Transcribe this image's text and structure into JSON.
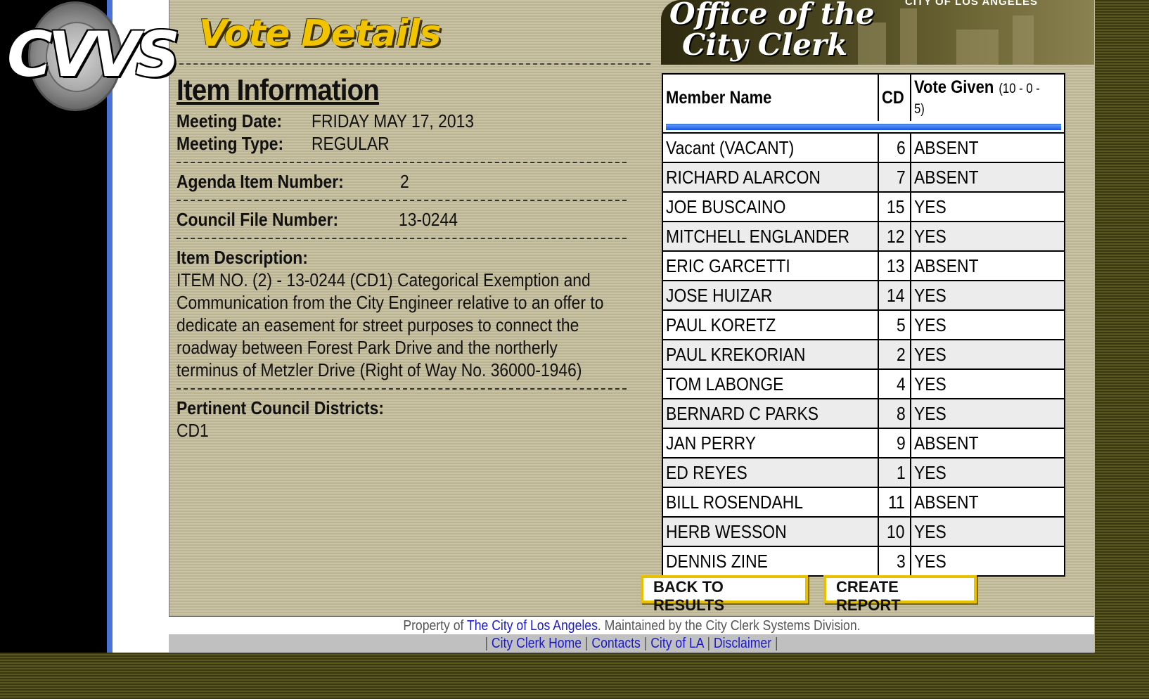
{
  "brand": {
    "logo_text": "CVVS",
    "office_title_line1": "Office of the",
    "office_title_line2": "City Clerk",
    "city_label": "CITY OF LOS ANGELES"
  },
  "page_title": "Vote Details",
  "item_info": {
    "heading": "Item Information",
    "meeting_date_label": "Meeting Date:",
    "meeting_date": "FRIDAY MAY 17, 2013",
    "meeting_type_label": "Meeting Type:",
    "meeting_type": "REGULAR",
    "agenda_item_label": "Agenda Item Number:",
    "agenda_item": "2",
    "council_file_label": "Council File Number:",
    "council_file": "13-0244",
    "description_label": "Item Description:",
    "description": "ITEM NO. (2) - 13-0244 (CD1) Categorical Exemption and Communication from the City Engineer relative to an offer to dedicate an easement for street purposes to connect the roadway between Forest Park Drive and the northerly terminus of Metzler Drive (Right of Way No. 36000-1946)",
    "districts_label": "Pertinent Council Districts:",
    "districts": "CD1"
  },
  "votes": {
    "col_member": "Member Name",
    "col_cd": "CD",
    "col_vote": "Vote Given",
    "tally": "(10 - 0 - 5)",
    "rows": [
      {
        "name": "Vacant (VACANT)",
        "cd": "6",
        "vote": "ABSENT"
      },
      {
        "name": "RICHARD ALARCON",
        "cd": "7",
        "vote": "ABSENT"
      },
      {
        "name": "JOE BUSCAINO",
        "cd": "15",
        "vote": "YES"
      },
      {
        "name": "MITCHELL ENGLANDER",
        "cd": "12",
        "vote": "YES"
      },
      {
        "name": "ERIC GARCETTI",
        "cd": "13",
        "vote": "ABSENT"
      },
      {
        "name": "JOSE HUIZAR",
        "cd": "14",
        "vote": "YES"
      },
      {
        "name": "PAUL KORETZ",
        "cd": "5",
        "vote": "YES"
      },
      {
        "name": "PAUL KREKORIAN",
        "cd": "2",
        "vote": "YES"
      },
      {
        "name": "TOM LABONGE",
        "cd": "4",
        "vote": "YES"
      },
      {
        "name": "BERNARD C PARKS",
        "cd": "8",
        "vote": "YES"
      },
      {
        "name": "JAN PERRY",
        "cd": "9",
        "vote": "ABSENT"
      },
      {
        "name": "ED REYES",
        "cd": "1",
        "vote": "YES"
      },
      {
        "name": "BILL ROSENDAHL",
        "cd": "11",
        "vote": "ABSENT"
      },
      {
        "name": "HERB WESSON",
        "cd": "10",
        "vote": "YES"
      },
      {
        "name": "DENNIS ZINE",
        "cd": "3",
        "vote": "YES"
      }
    ]
  },
  "buttons": {
    "back": "BACK TO RESULTS",
    "report": "CREATE REPORT"
  },
  "footer": {
    "prefix": "Property of",
    "city_link": "The City of Los Angeles",
    "suffix": ". Maintained by the City Clerk Systems Division.",
    "links": [
      "City Clerk Home",
      "Contacts",
      "City of LA",
      "Disclaimer"
    ],
    "separator": "|"
  },
  "colors": {
    "title_yellow": "#f2c400",
    "link_blue": "#1a1acc",
    "button_border": "#e8c000"
  }
}
